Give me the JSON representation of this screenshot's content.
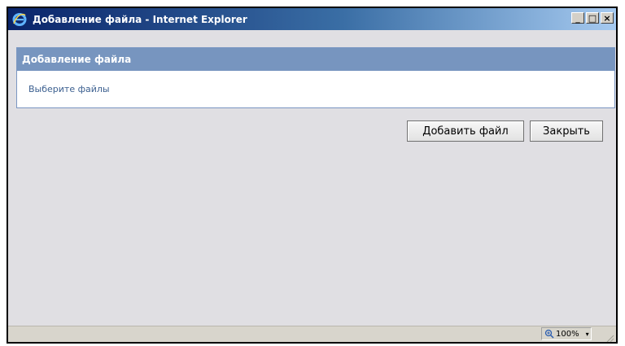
{
  "window": {
    "title": "Добавление файла - Internet Explorer",
    "minimize_glyph": "_",
    "maximize_glyph": "□",
    "close_glyph": "×"
  },
  "panel": {
    "header": "Добавление файла",
    "body_text": "Выберите файлы"
  },
  "buttons": {
    "add_label": "Добавить файл",
    "close_label": "Закрыть"
  },
  "statusbar": {
    "zoom_value": "100%",
    "zoom_caret": "▾"
  },
  "colors": {
    "title_gradient_start": "#0a246a",
    "title_gradient_end": "#a6caf0",
    "panel_header": "#7795bf",
    "client_bg": "#e0dfe3",
    "body_text": "#3b5f8f"
  },
  "icons": {
    "app": "internet-explorer-icon",
    "zoom": "zoom-icon",
    "resize": "resize-grip-icon"
  }
}
